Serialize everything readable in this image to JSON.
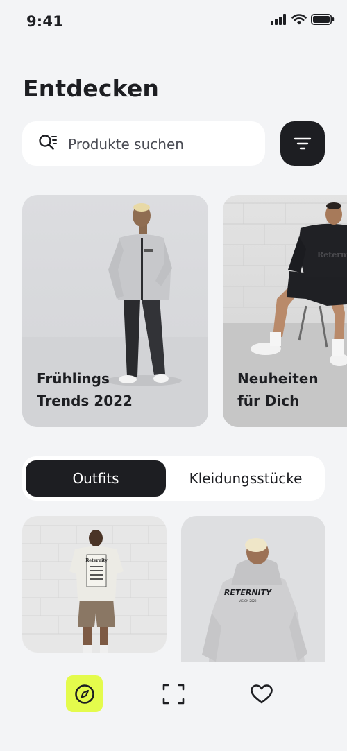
{
  "status_bar": {
    "time": "9:41"
  },
  "page": {
    "title": "Entdecken"
  },
  "search": {
    "placeholder": "Produkte suchen"
  },
  "featured": [
    {
      "line1": "Frühlings",
      "line2": "Trends 2022"
    },
    {
      "line1": "Neuheiten",
      "line2": "für Dich"
    }
  ],
  "tabs": {
    "active": "Outfits",
    "inactive": "Kleidungsstücke"
  },
  "products": [
    {
      "print": "Reternity"
    },
    {
      "print": "RETERNITY",
      "print_sub": "VISION 2022"
    }
  ],
  "colors": {
    "dark": "#1d1e22",
    "accent": "#e4fb4c",
    "background": "#f3f4f6",
    "surface": "#ffffff"
  },
  "icons": {
    "search": "search-icon",
    "filter": "filter-icon",
    "explore": "compass-icon",
    "scan": "scan-icon",
    "favorites": "heart-icon"
  }
}
